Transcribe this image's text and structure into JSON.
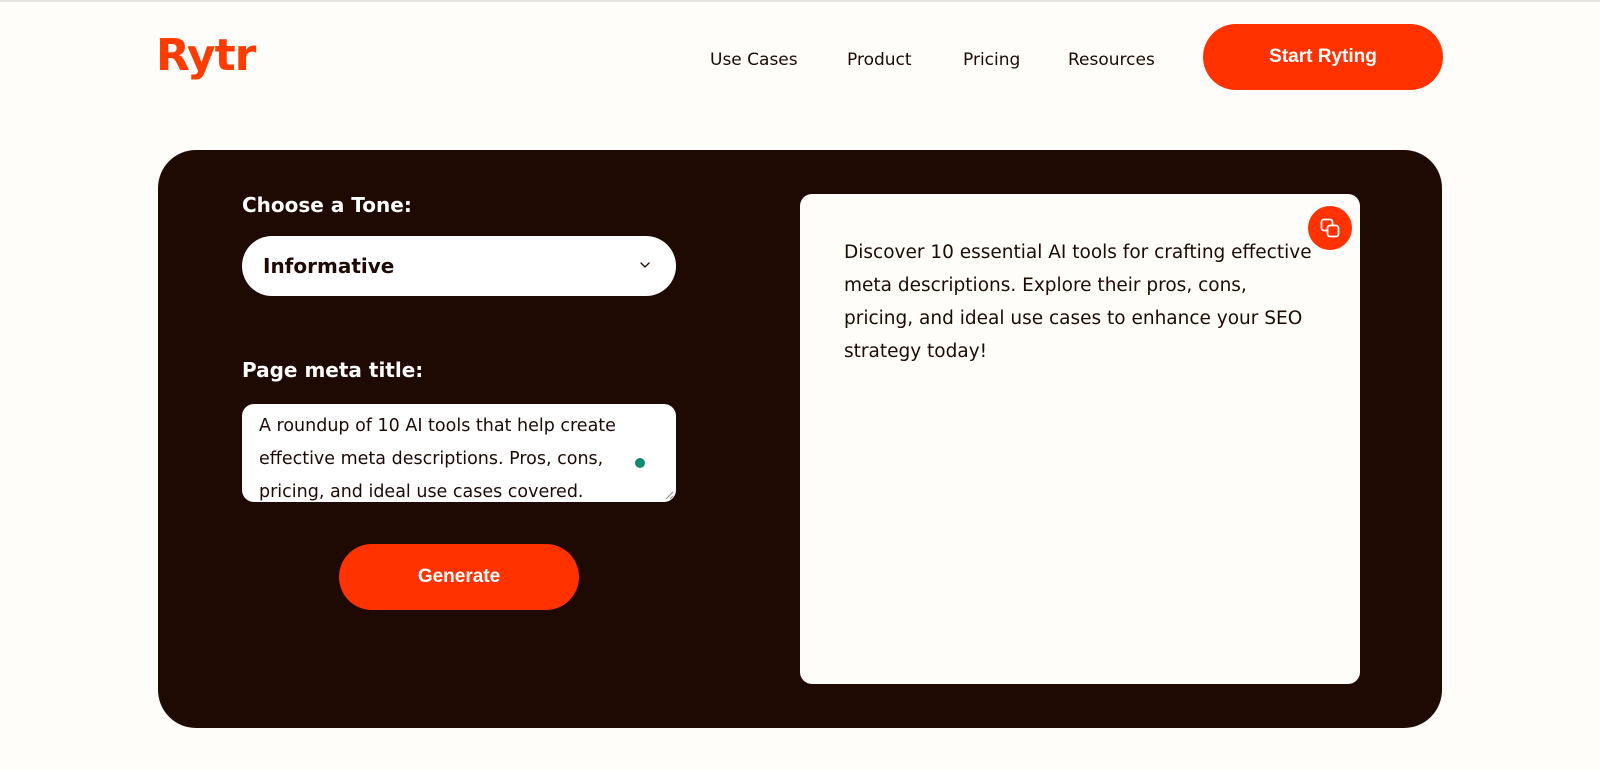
{
  "brand": {
    "logo_text": "Rytr",
    "accent_color": "#ff3200"
  },
  "nav": {
    "items": [
      {
        "label": "Use Cases"
      },
      {
        "label": "Product"
      },
      {
        "label": "Pricing"
      },
      {
        "label": "Resources"
      }
    ],
    "cta_label": "Start Ryting"
  },
  "form": {
    "tone_label": "Choose a Tone:",
    "tone_value": "Informative",
    "meta_title_label": "Page meta title:",
    "meta_title_value": "A roundup of 10 AI tools that help create effective meta descriptions. Pros, cons, pricing, and ideal use cases covered.",
    "generate_label": "Generate"
  },
  "output": {
    "text": "Discover 10 essential AI tools for crafting effective meta descriptions. Explore their pros, cons, pricing, and ideal use cases to enhance your SEO strategy today!",
    "copy_icon": "copy-icon"
  }
}
